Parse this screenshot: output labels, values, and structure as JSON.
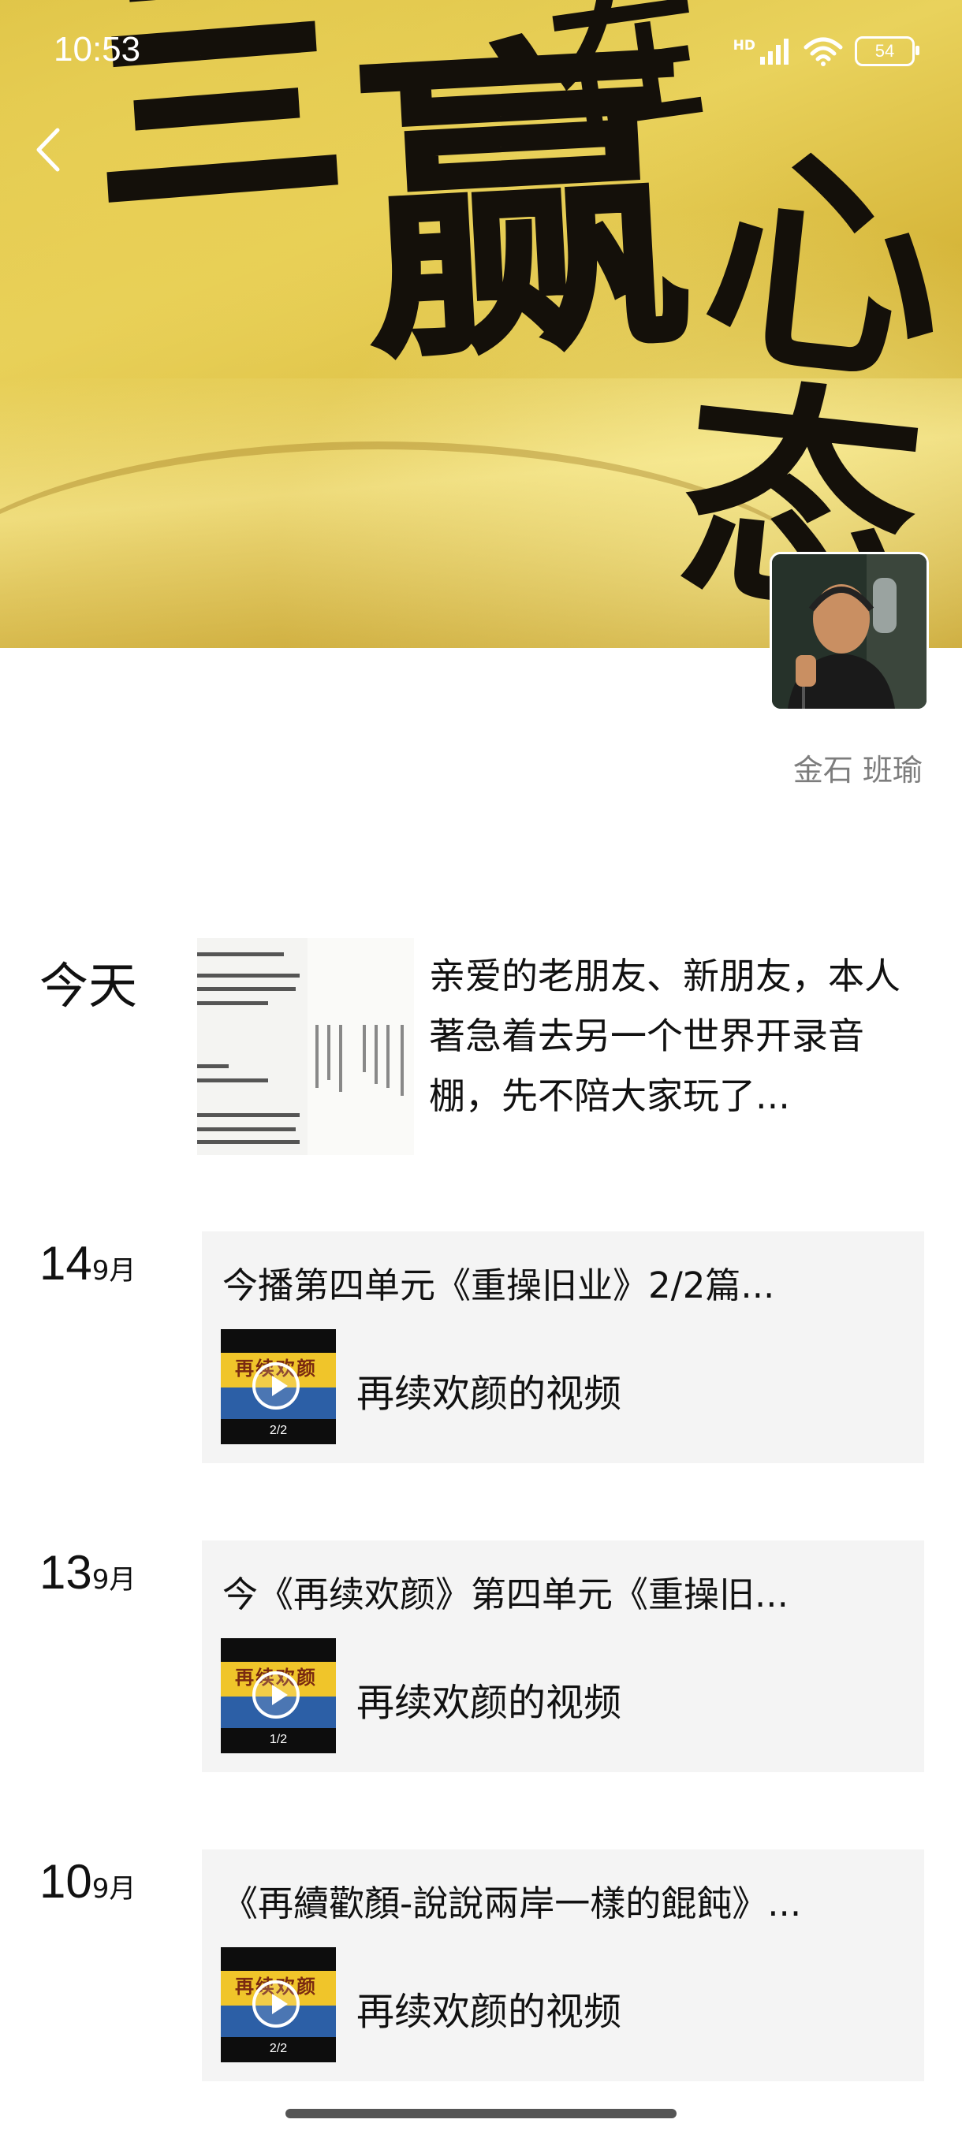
{
  "status_bar": {
    "time": "10:53",
    "network": "HD",
    "battery": "54"
  },
  "cover": {
    "calligraphy": [
      "亖",
      "在",
      "赢",
      "心态"
    ]
  },
  "profile": {
    "name": "金石 班瑜"
  },
  "posts": [
    {
      "date_label": "今天",
      "text": "亲爱的老朋友、新朋友，本人著急着去另一个世界开录音棚，先不陪大家玩了..."
    },
    {
      "day": "14",
      "month": "9月",
      "title": "今播第四单元《重操旧业》2/2篇...",
      "video_label": "再续欢颜的视频",
      "thumb_title": "再续欢颜",
      "thumb_page": "2/2"
    },
    {
      "day": "13",
      "month": "9月",
      "title": "今《再续欢颜》第四单元《重操旧...",
      "video_label": "再续欢颜的视频",
      "thumb_title": "再续欢颜",
      "thumb_page": "1/2"
    },
    {
      "day": "10",
      "month": "9月",
      "title": "《再續歡顏-說說兩岸一樣的餛飩》...",
      "video_label": "再续欢颜的视频",
      "thumb_title": "再续欢颜",
      "thumb_page": "2/2"
    }
  ],
  "colors": {
    "cover_gold": "#dcc042",
    "card_bg": "#f4f4f4",
    "author_gray": "#7d7d7d"
  }
}
